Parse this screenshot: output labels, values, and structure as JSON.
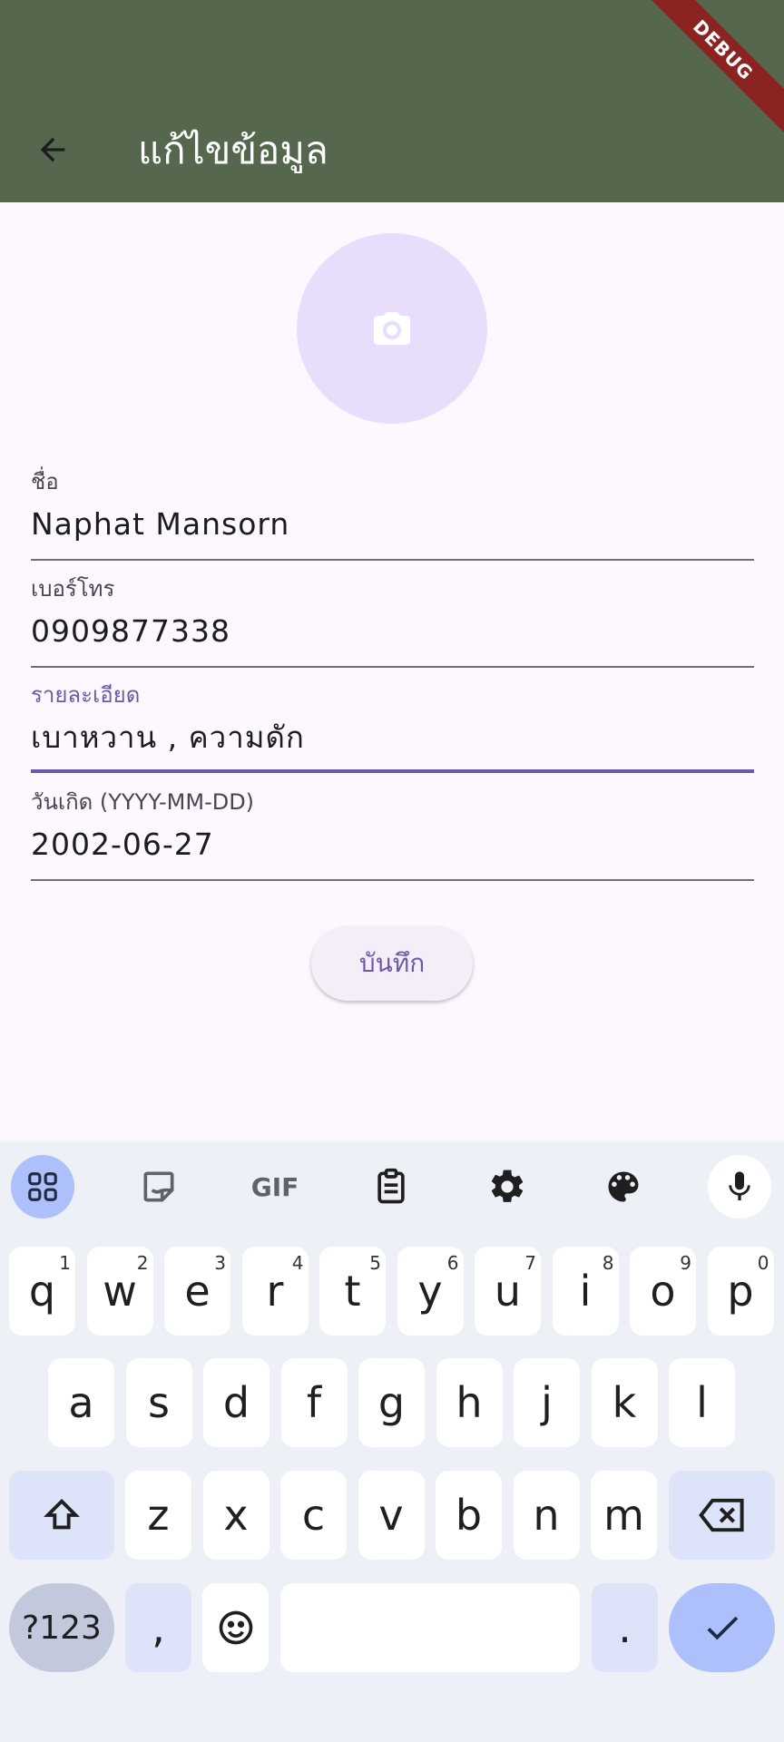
{
  "app_bar": {
    "title": "แก้ไขข้อมูล",
    "back_icon": "arrow-back-icon",
    "color": "#55684d"
  },
  "debug_banner": "DEBUG",
  "avatar": {
    "icon": "camera-icon"
  },
  "form": {
    "name": {
      "label": "ชื่อ",
      "value": "Naphat Mansorn"
    },
    "phone": {
      "label": "เบอร์โทร",
      "value": "0909877338"
    },
    "details": {
      "label": "รายละเอียด",
      "value": "เบาหวาน , ความดัก"
    },
    "birthday": {
      "label": "วันเกิด (YYYY-MM-DD)",
      "value": "2002-06-27"
    }
  },
  "save_button": {
    "label": "บันทึก"
  },
  "keyboard": {
    "toolbar": [
      "apps-grid-icon",
      "sticker-icon",
      "gif-icon",
      "clipboard-icon",
      "gear-icon",
      "palette-icon",
      "microphone-icon"
    ],
    "gif_label": "GIF",
    "row1": [
      {
        "k": "q",
        "h": "1"
      },
      {
        "k": "w",
        "h": "2"
      },
      {
        "k": "e",
        "h": "3"
      },
      {
        "k": "r",
        "h": "4"
      },
      {
        "k": "t",
        "h": "5"
      },
      {
        "k": "y",
        "h": "6"
      },
      {
        "k": "u",
        "h": "7"
      },
      {
        "k": "i",
        "h": "8"
      },
      {
        "k": "o",
        "h": "9"
      },
      {
        "k": "p",
        "h": "0"
      }
    ],
    "row2": [
      "a",
      "s",
      "d",
      "f",
      "g",
      "h",
      "j",
      "k",
      "l"
    ],
    "row3": [
      "z",
      "x",
      "c",
      "v",
      "b",
      "n",
      "m"
    ],
    "symbols_label": "?123",
    "comma_label": ",",
    "period_label": "."
  }
}
